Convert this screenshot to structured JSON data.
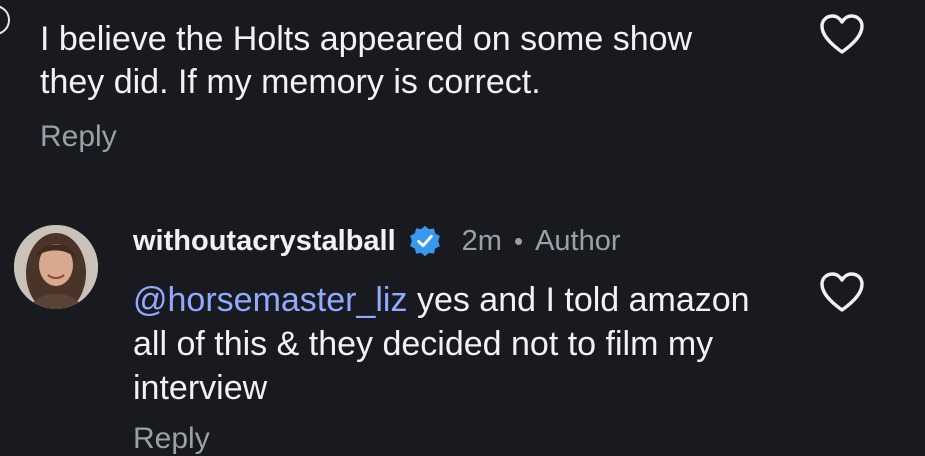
{
  "comments": [
    {
      "text": "I believe the Holts appeared on some show they did. If my memory is correct.",
      "reply_label": "Reply"
    },
    {
      "username": "withoutacrystalball",
      "timestamp": "2m",
      "separator": "•",
      "badge": "Author",
      "mention": "@horsemaster_liz",
      "text": " yes and I told amazon all of this & they decided not to film my interview",
      "reply_label": "Reply"
    }
  ],
  "icons": {
    "like": "heart-outline-icon",
    "verified": "verified-badge-icon",
    "verified_color": "#3897f0"
  },
  "colors": {
    "background": "#181a1f",
    "text": "#f2f2f2",
    "secondary": "#9aa0a6",
    "mention": "#91a9ff"
  }
}
